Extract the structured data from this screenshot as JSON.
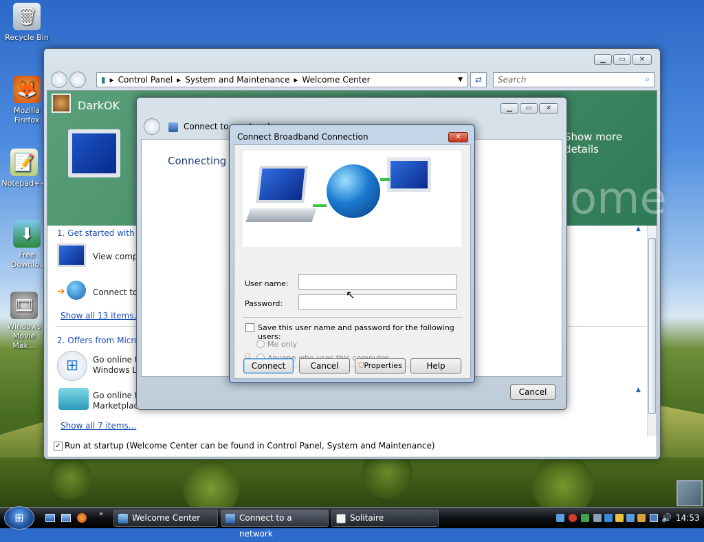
{
  "desktop": {
    "icons": [
      {
        "label": "Recycle Bin",
        "glyph": "🗑"
      },
      {
        "label": "Mozilla Firefox",
        "glyph": "🦊"
      },
      {
        "label": "Notepad++",
        "glyph": "📝"
      },
      {
        "label": "Free Downlo...",
        "glyph": "⬇"
      },
      {
        "label": "Windows Movie Mak...",
        "glyph": "🎞"
      }
    ]
  },
  "welcome": {
    "breadcrumb": [
      "Control Panel",
      "System and Maintenance",
      "Welcome Center"
    ],
    "search_placeholder": "Search",
    "user": "DarkOK",
    "more_details": "Show more details",
    "watermark": "ome",
    "section1": "1. Get started with Win",
    "items1": [
      "View comput",
      "Connect to t"
    ],
    "show_all1": "Show all 13 items...",
    "section2": "2. Offers from Microso",
    "items2": [
      "Go online to\nWindows Liv",
      "Go online to\nMarketplace"
    ],
    "show_all2": "Show all 7 items...",
    "startup": "Run at startup (Welcome Center can be found in Control Panel, System and Maintenance)"
  },
  "network": {
    "title": "Connect to a network",
    "heading": "Connecting t",
    "cancel": "Cancel"
  },
  "broadband": {
    "title": "Connect Broadband Connection",
    "user_label": "User name:",
    "user_value": "",
    "password_label": "Password:",
    "password_value": "",
    "save_label": "Save this user name and password for the following users:",
    "me_only": "Me only",
    "anyone": "Anyone who uses this computer",
    "connect": "Connect",
    "cancel": "Cancel",
    "properties": "Properties",
    "help": "Help"
  },
  "taskbar": {
    "items": [
      "Welcome Center",
      "Connect to a network",
      "Solitaire"
    ],
    "time": "14:53"
  }
}
